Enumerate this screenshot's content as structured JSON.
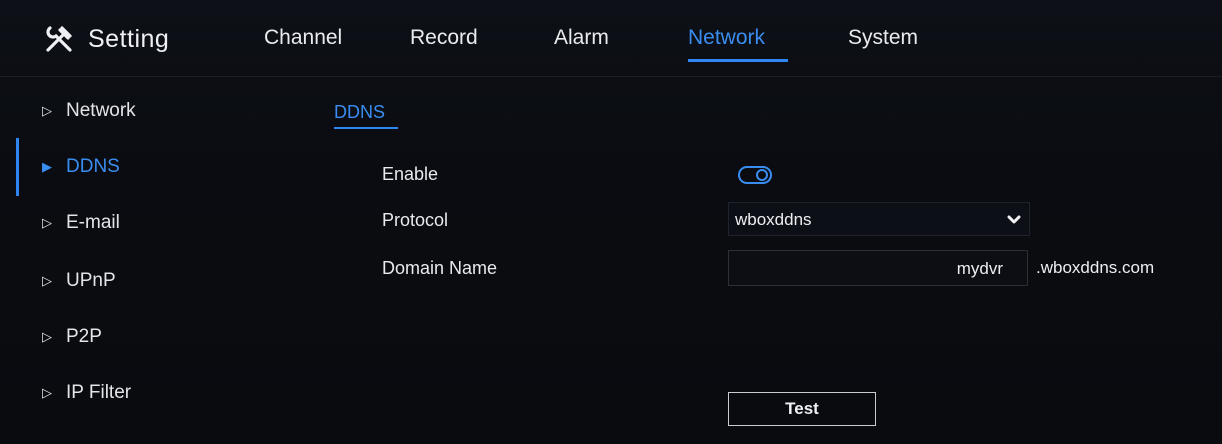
{
  "header": {
    "title": "Setting",
    "title_icon": "tools-icon",
    "tabs": [
      {
        "label": "Channel"
      },
      {
        "label": "Record"
      },
      {
        "label": "Alarm"
      },
      {
        "label": "Network",
        "active": true
      },
      {
        "label": "System"
      }
    ]
  },
  "sidebar": {
    "items": [
      {
        "label": "Network"
      },
      {
        "label": "DDNS",
        "active": true
      },
      {
        "label": "E-mail"
      },
      {
        "label": "UPnP"
      },
      {
        "label": "P2P"
      },
      {
        "label": "IP Filter"
      }
    ]
  },
  "subtab": {
    "label": "DDNS"
  },
  "form": {
    "enable_label": "Enable",
    "enable_on": true,
    "protocol_label": "Protocol",
    "protocol_value": "wboxddns",
    "domain_label": "Domain Name",
    "domain_value": "mydvr",
    "domain_suffix": ".wboxddns.com",
    "test_label": "Test"
  },
  "colors": {
    "accent": "#2f86f2",
    "background": "#0a0c10",
    "text": "#e6e8ec"
  }
}
